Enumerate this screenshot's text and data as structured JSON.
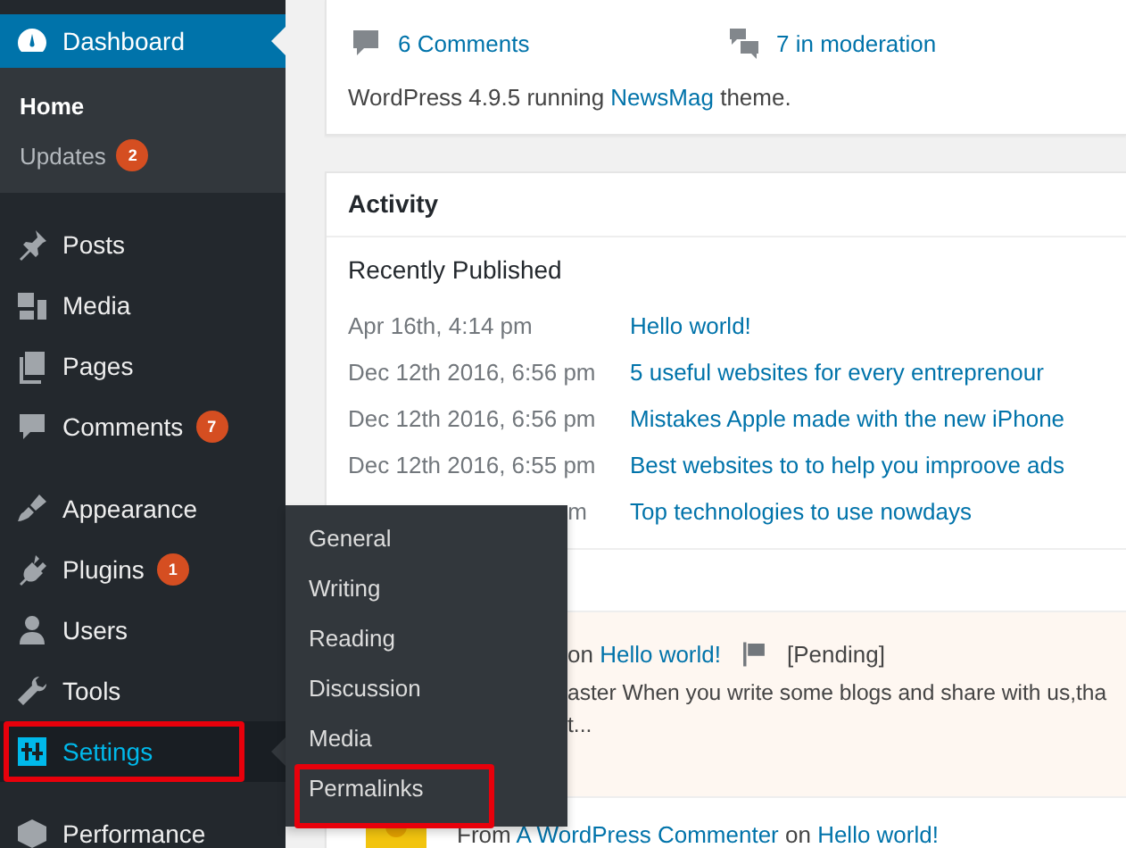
{
  "sidebar": {
    "groups": [
      {
        "items": [
          {
            "label": "Dashboard",
            "selected": true,
            "hovered": false,
            "highlighted": false,
            "children": [
              {
                "label": "Home",
                "selected": true
              },
              {
                "label": "Updates",
                "badge": "2",
                "selected": false
              }
            ]
          }
        ]
      },
      {
        "items": [
          {
            "label": "Posts",
            "selected": false,
            "hovered": false,
            "highlighted": false
          },
          {
            "label": "Media",
            "selected": false,
            "hovered": false,
            "highlighted": false
          },
          {
            "label": "Pages",
            "selected": false,
            "hovered": false,
            "highlighted": false
          },
          {
            "label": "Comments",
            "badge": "7",
            "selected": false,
            "hovered": false,
            "highlighted": false
          }
        ]
      },
      {
        "items": [
          {
            "label": "Appearance",
            "selected": false,
            "hovered": false,
            "highlighted": false
          },
          {
            "label": "Plugins",
            "badge": "1",
            "selected": false,
            "hovered": false,
            "highlighted": false
          },
          {
            "label": "Users",
            "selected": false,
            "hovered": false,
            "highlighted": false
          },
          {
            "label": "Tools",
            "selected": false,
            "hovered": false,
            "highlighted": false
          },
          {
            "label": "Settings",
            "selected": false,
            "hovered": true,
            "highlighted": true
          }
        ]
      },
      {
        "items": [
          {
            "label": "Performance",
            "selected": false,
            "hovered": false,
            "highlighted": false
          }
        ]
      }
    ]
  },
  "flyout": {
    "items": [
      {
        "label": "General",
        "highlighted": false
      },
      {
        "label": "Writing",
        "highlighted": false
      },
      {
        "label": "Reading",
        "highlighted": false
      },
      {
        "label": "Discussion",
        "highlighted": false
      },
      {
        "label": "Media",
        "highlighted": false
      },
      {
        "label": "Permalinks",
        "highlighted": true
      }
    ]
  },
  "at_a_glance": {
    "stats": [
      {
        "label": "6 Comments"
      },
      {
        "label": "7 in moderation"
      }
    ],
    "version_text": "WordPress 4.9.5 running",
    "theme_link": "NewsMag",
    "version_suffix": "theme."
  },
  "activity": {
    "title": "Activity",
    "recent_heading": "Recently Published",
    "posts": [
      {
        "date": "Apr 16th, 4:14 pm",
        "title": "Hello world!"
      },
      {
        "date": "Dec 12th 2016, 6:56 pm",
        "title": "5 useful websites for every entreprenour"
      },
      {
        "date": "Dec 12th 2016, 6:56 pm",
        "title": "Mistakes Apple made with the new iPhone"
      },
      {
        "date": "Dec 12th 2016, 6:55 pm",
        "title": "Best websites to to help you improove ads"
      },
      {
        "date": "m",
        "title": "Top technologies to use nowdays"
      }
    ],
    "comments": [
      {
        "pending": true,
        "on": "on",
        "post": "Hello world!",
        "status": "[Pending]",
        "excerpt": [
          "aster When you write some blogs and share with us,tha",
          "t..."
        ]
      },
      {
        "pending": false,
        "prefix": "From",
        "author": "A WordPress Commenter",
        "on": "on",
        "post": "Hello world!"
      }
    ]
  }
}
